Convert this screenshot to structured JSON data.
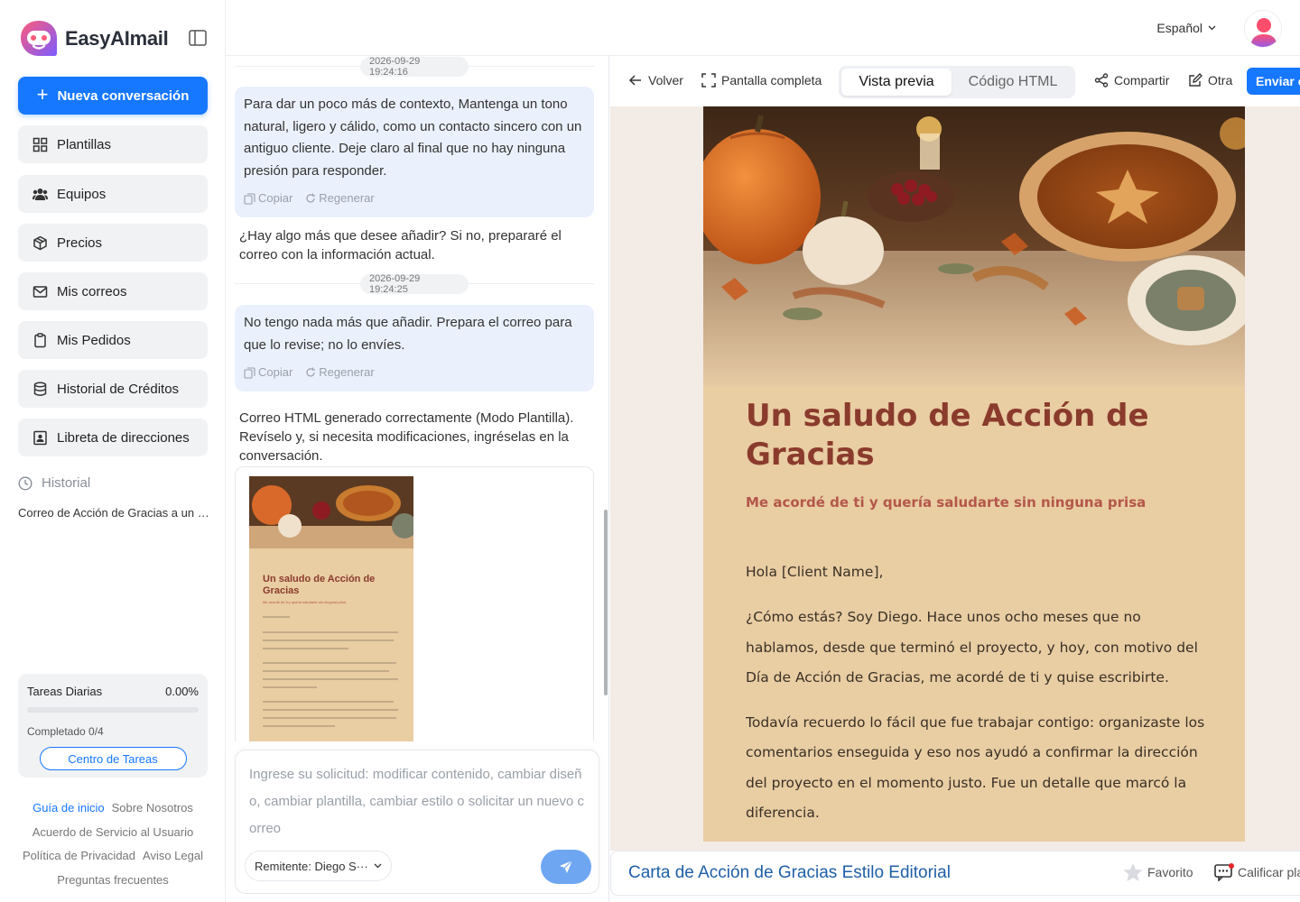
{
  "app": {
    "name": "EasyAImail"
  },
  "sidebar": {
    "new_conversation": "Nueva conversación",
    "items": [
      {
        "label": "Plantillas",
        "icon": "grid-icon"
      },
      {
        "label": "Equipos",
        "icon": "team-icon"
      },
      {
        "label": "Precios",
        "icon": "box-icon"
      },
      {
        "label": "Mis correos",
        "icon": "mail-icon"
      },
      {
        "label": "Mis Pedidos",
        "icon": "clipboard-icon"
      },
      {
        "label": "Historial de Créditos",
        "icon": "database-icon"
      },
      {
        "label": "Libreta de direcciones",
        "icon": "contact-book-icon"
      }
    ],
    "history_label": "Historial",
    "history_items": [
      "Correo de Acción de Gracias a un …"
    ],
    "tasks": {
      "label": "Tareas Diarias",
      "percent": "0.00%",
      "progress": 0,
      "completed": "Completado 0/4",
      "button": "Centro de Tareas"
    },
    "footer_links": [
      [
        "Guía de inicio",
        "Sobre Nosotros"
      ],
      [
        "Acuerdo de Servicio al Usuario"
      ],
      [
        "Política de Privacidad",
        "Aviso Legal"
      ],
      [
        "Preguntas frecuentes"
      ]
    ]
  },
  "topbar": {
    "language": "Español"
  },
  "chat": {
    "timestamps": [
      "2026-09-29 19:24:16",
      "2026-09-29 19:24:25"
    ],
    "messages": [
      {
        "role": "user",
        "text": "Para dar un poco más de contexto, Mantenga un tono natural, ligero y cálido, como un contacto sincero con un antiguo cliente. Deje claro al final que no hay ninguna presión para responder."
      },
      {
        "role": "assistant",
        "text": "¿Hay algo más que desee añadir? Si no, prepararé el correo con la información actual."
      },
      {
        "role": "user",
        "text": "No tengo nada más que añadir. Prepara el correo para que lo revise; no lo envíes."
      },
      {
        "role": "assistant",
        "text": "Correo HTML generado correctamente (Modo Plantilla). Revíselo y, si necesita modificaciones, ingréselas en la conversación."
      }
    ],
    "actions": {
      "copy": "Copiar",
      "regenerate": "Regenerar"
    },
    "thumbnail": {
      "title": "Un saludo de Acción de Gracias",
      "subtitle": "Me acordé de ti y quería saludarte sin ninguna prisa",
      "greeting": "Hola [Client Name],"
    },
    "composer": {
      "placeholder": "Ingrese su solicitud: modificar contenido, cambiar diseño, cambiar plantilla, cambiar estilo o solicitar un nuevo correo",
      "sender": "Remitente: Diego S···"
    }
  },
  "preview": {
    "toolbar": {
      "back": "Volver",
      "fullscreen": "Pantalla completa",
      "tab_preview": "Vista previa",
      "tab_html": "Código HTML",
      "share": "Compartir",
      "other": "Otra",
      "send": "Enviar c"
    },
    "email": {
      "title": "Un saludo de Acción de Gracias",
      "subtitle": "Me acordé de ti y quería saludarte sin ninguna prisa",
      "paragraphs": [
        "Hola [Client Name],",
        "¿Cómo estás? Soy Diego. Hace unos ocho meses que no hablamos, desde que terminó el proyecto, y hoy, con motivo del Día de Acción de Gracias, me acordé de ti y quise escribirte.",
        "Todavía recuerdo lo fácil que fue trabajar contigo: organizaste los comentarios enseguida y eso nos ayudó a confirmar la dirección del proyecto en el momento justo. Fue un detalle que marcó la diferencia."
      ]
    },
    "footer": {
      "template_name": "Carta de Acción de Gracias Estilo Editorial",
      "favorite": "Favorito",
      "rate": "Calificar pla"
    }
  },
  "colors": {
    "accent": "#1677ff",
    "email_background": "#e9cda3",
    "email_title": "#8a3b2c",
    "email_subtitle": "#b4574a"
  }
}
